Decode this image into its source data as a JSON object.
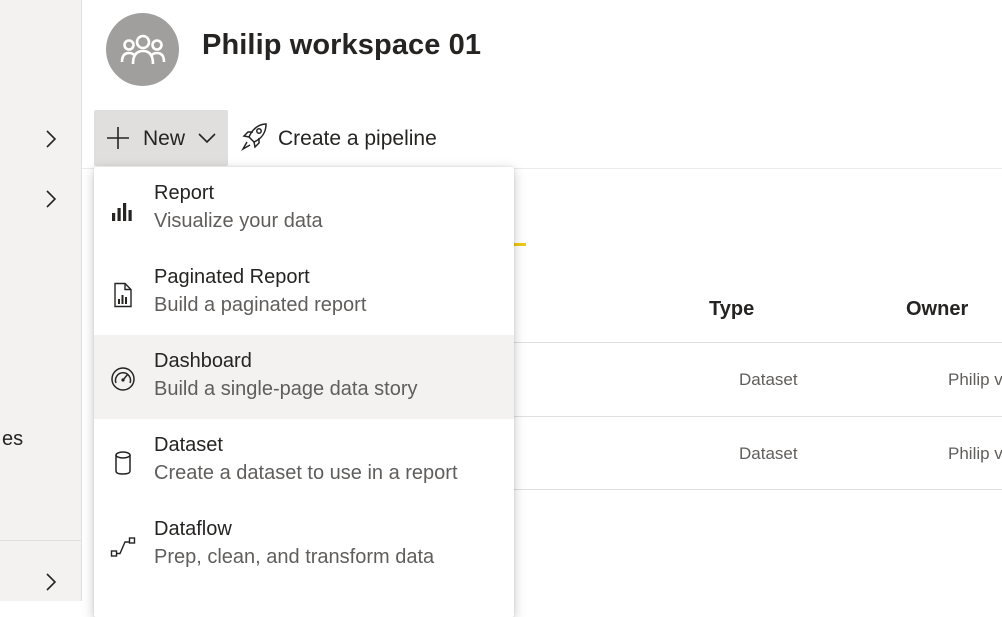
{
  "workspace": {
    "title": "Philip workspace 01",
    "avatar_icon": "people-group-icon",
    "avatar_color": "#a19f9d"
  },
  "leftnav": {
    "partial_label": "es",
    "chevron_icon": "chevron-right-icon"
  },
  "toolbar": {
    "new_label": "New",
    "pipeline_label": "Create a pipeline"
  },
  "table": {
    "columns": [
      "Type",
      "Owner"
    ],
    "rows": [
      {
        "type": "Dataset",
        "owner": "Philip v"
      },
      {
        "type": "Dataset",
        "owner": "Philip v"
      }
    ]
  },
  "menu": {
    "items": [
      {
        "title": "Report",
        "desc": "Visualize your data",
        "icon": "bar-chart-icon"
      },
      {
        "title": "Paginated Report",
        "desc": "Build a paginated report",
        "icon": "paginated-report-icon"
      },
      {
        "title": "Dashboard",
        "desc": "Build a single-page data story",
        "icon": "gauge-icon",
        "hovered": true
      },
      {
        "title": "Dataset",
        "desc": "Create a dataset to use in a report",
        "icon": "database-icon"
      },
      {
        "title": "Dataflow",
        "desc": "Prep, clean, and transform data",
        "icon": "dataflow-icon"
      }
    ]
  },
  "colors": {
    "accent_yellow": "#f2c811",
    "hover_bg": "#f3f2f1",
    "button_bg": "#e1dfdd"
  }
}
